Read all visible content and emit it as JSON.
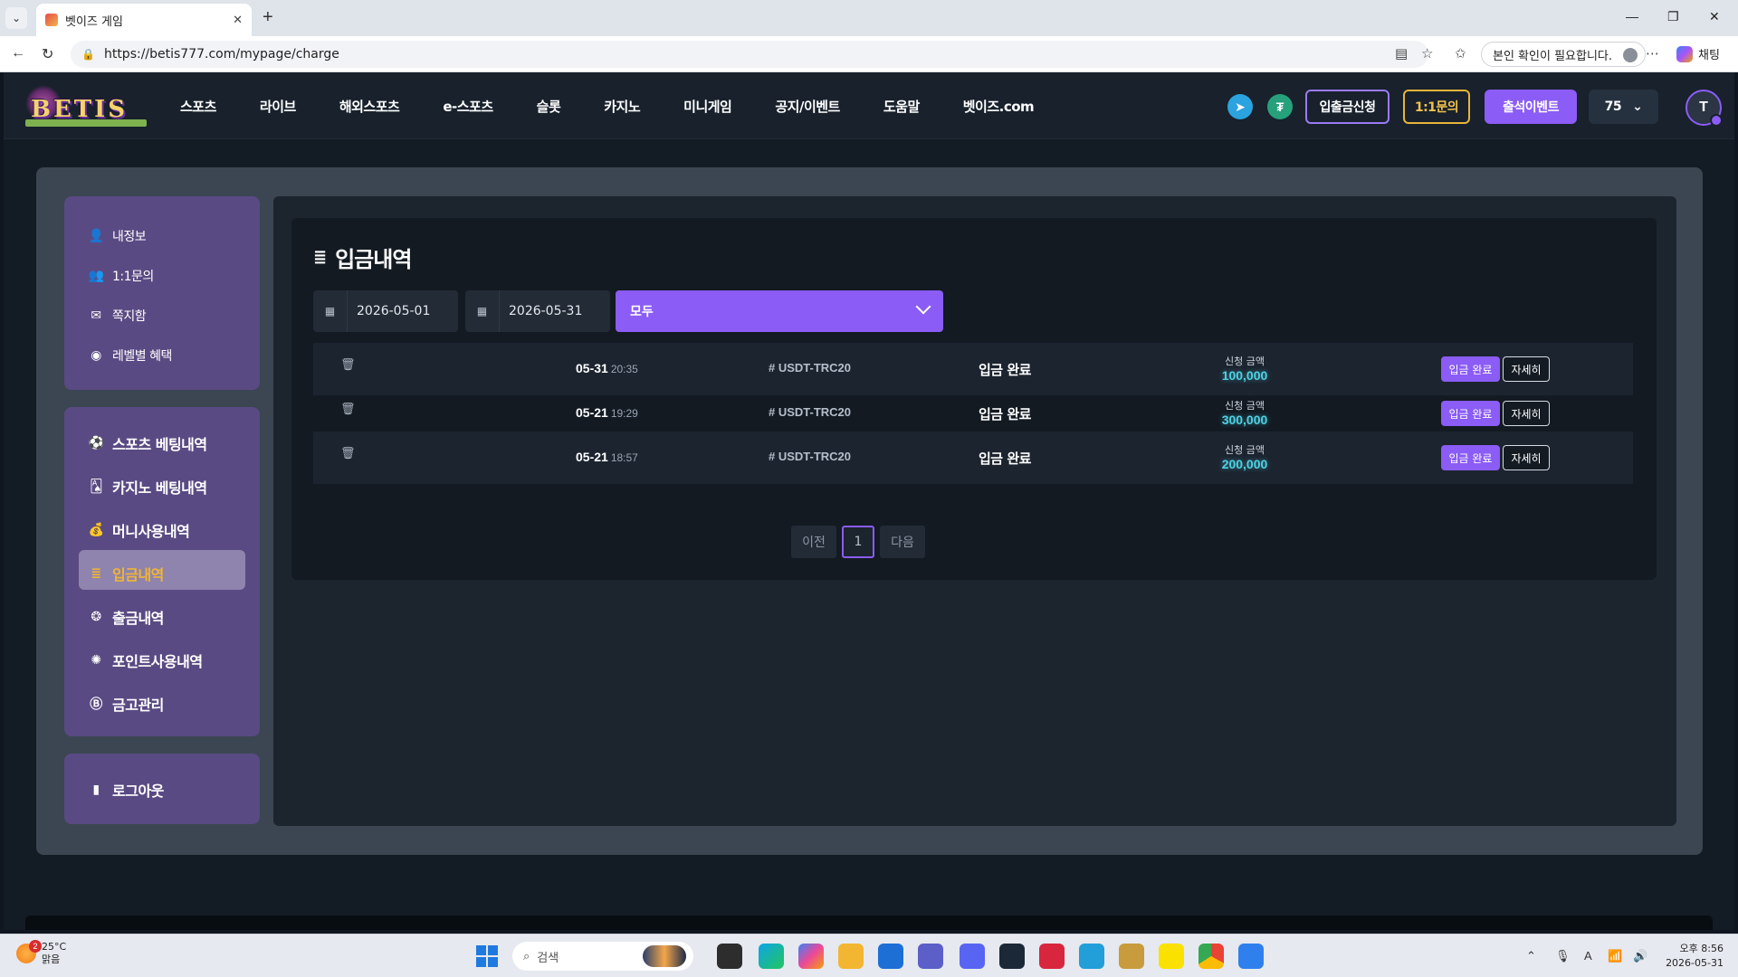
{
  "browser": {
    "tab_title": "벳이즈 게임",
    "url": "https://betis777.com/mypage/charge",
    "verify_label": "본인 확인이 필요합니다.",
    "chat_label": "채팅"
  },
  "site": {
    "logo_text": "BETIS",
    "nav": [
      "스포츠",
      "라이브",
      "해외스포츠",
      "e-스포츠",
      "슬롯",
      "카지노",
      "미니게임",
      "공지/이벤트",
      "도움말",
      "벳이즈.com"
    ],
    "header": {
      "deposit_request": "입출금신청",
      "inquiry": "1:1문의",
      "attendance_event": "출석이벤트",
      "level": "75",
      "avatar_letter": "T"
    },
    "sidebar": {
      "group1": [
        {
          "label": "내정보",
          "icon": "user-icon"
        },
        {
          "label": "1:1문의",
          "icon": "users-icon"
        },
        {
          "label": "쪽지함",
          "icon": "message-icon"
        },
        {
          "label": "레벨별 혜택",
          "icon": "level-icon"
        }
      ],
      "group2": [
        {
          "label": "스포츠 베팅내역",
          "icon": "soccer-icon"
        },
        {
          "label": "카지노 베팅내역",
          "icon": "card-icon"
        },
        {
          "label": "머니사용내역",
          "icon": "money-bag-icon"
        },
        {
          "label": "입금내역",
          "icon": "deposit-icon"
        },
        {
          "label": "출금내역",
          "icon": "withdraw-icon"
        },
        {
          "label": "포인트사용내역",
          "icon": "point-icon"
        },
        {
          "label": "금고관리",
          "icon": "vault-icon"
        }
      ],
      "group3": [
        {
          "label": "로그아웃",
          "icon": "logout-icon"
        }
      ],
      "active": "입금내역"
    },
    "main": {
      "title": "입금내역",
      "date_from": "2026-05-01",
      "date_to": "2026-05-31",
      "filter": "모두",
      "amount_label": "신청 금액",
      "done_button": "입금 완료",
      "detail_button": "자세히",
      "rows": [
        {
          "date": "05-31",
          "time": "20:35",
          "method": "# USDT-TRC20",
          "status": "입금 완료",
          "amount": "100,000"
        },
        {
          "date": "05-21",
          "time": "19:29",
          "method": "# USDT-TRC20",
          "status": "입금 완료",
          "amount": "300,000"
        },
        {
          "date": "05-21",
          "time": "18:57",
          "method": "# USDT-TRC20",
          "status": "입금 완료",
          "amount": "200,000"
        }
      ],
      "pagination": {
        "prev": "이전",
        "page": "1",
        "next": "다음"
      }
    }
  },
  "taskbar": {
    "weather_badge": "2",
    "temperature": "25°C",
    "weather": "맑음",
    "search_placeholder": "검색",
    "time": "오후 8:56",
    "date": "2026-05-31"
  },
  "colors": {
    "accent": "#8b5cf6",
    "active_sidebar_text": "#f0b437",
    "amount": "#4fd1e3",
    "sidebar_bg": "#5a4a83"
  }
}
